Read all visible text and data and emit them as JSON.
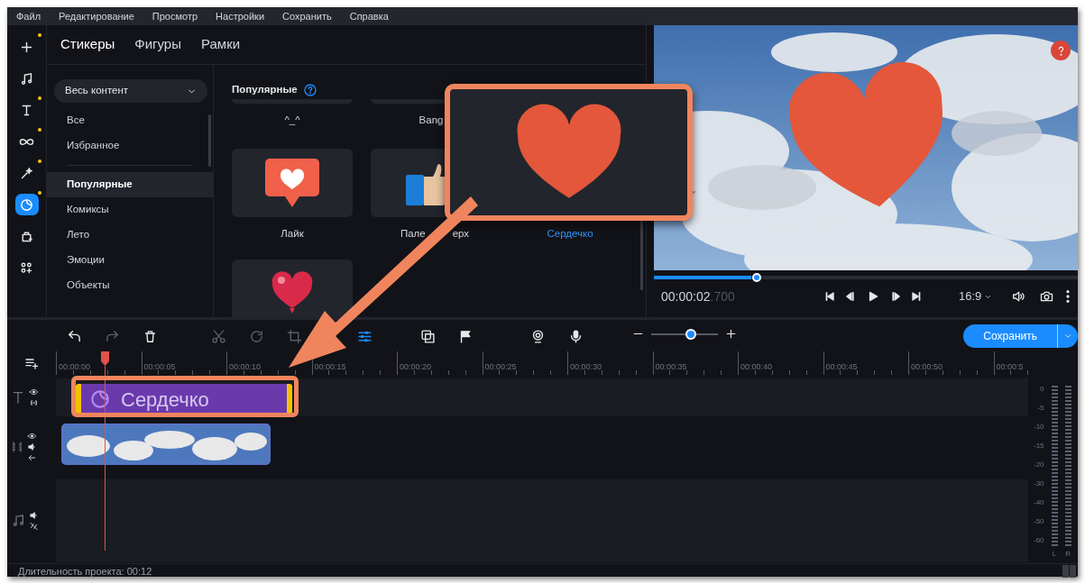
{
  "menu": [
    "Файл",
    "Редактирование",
    "Просмотр",
    "Настройки",
    "Сохранить",
    "Справка"
  ],
  "tool_rail": [
    {
      "kind": "add",
      "selected": false,
      "badge": true
    },
    {
      "kind": "music",
      "selected": false,
      "badge": false
    },
    {
      "kind": "text",
      "selected": false,
      "badge": true
    },
    {
      "kind": "transition",
      "selected": false,
      "badge": true
    },
    {
      "kind": "magic",
      "selected": false,
      "badge": true
    },
    {
      "kind": "sticker",
      "selected": true,
      "badge": true
    },
    {
      "kind": "clip",
      "selected": false,
      "badge": false
    },
    {
      "kind": "more",
      "selected": false,
      "badge": false
    }
  ],
  "tabs": [
    {
      "label": "Стикеры",
      "selected": true
    },
    {
      "label": "Фигуры",
      "selected": false
    },
    {
      "label": "Рамки",
      "selected": false
    }
  ],
  "categories": {
    "dropdown": "Весь контент",
    "filters": [
      {
        "label": "Все",
        "selected": false
      },
      {
        "label": "Избранное",
        "selected": false
      }
    ],
    "items": [
      {
        "label": "Популярные",
        "selected": true
      },
      {
        "label": "Комиксы",
        "selected": false
      },
      {
        "label": "Лето",
        "selected": false
      },
      {
        "label": "Эмоции",
        "selected": false
      },
      {
        "label": "Объекты",
        "selected": false
      }
    ]
  },
  "gallery": {
    "title": "Популярные",
    "partial_row": [
      "^_^",
      "Bang"
    ],
    "stickers": [
      {
        "kind": "like",
        "label": "Лайк",
        "selected": false
      },
      {
        "kind": "thumb",
        "label_parts": [
          "Пале",
          "ерх"
        ],
        "selected": false
      },
      {
        "kind": "heart",
        "label": "Сердечко",
        "selected": true
      },
      {
        "kind": "balloon"
      }
    ]
  },
  "preview": {
    "progress": {
      "level": 0.23
    },
    "time": "00:00:02",
    "time_fraction": ".700",
    "aspect": "16:9"
  },
  "timeline": {
    "tools": [
      [
        {
          "kind": "undo",
          "disabled": false,
          "active": false
        },
        {
          "kind": "redo",
          "disabled": true,
          "active": false
        },
        {
          "kind": "delete",
          "disabled": false,
          "active": false
        }
      ],
      [
        {
          "kind": "cut",
          "disabled": true,
          "active": false
        },
        {
          "kind": "rotate",
          "disabled": true,
          "active": false
        },
        {
          "kind": "crop",
          "disabled": true,
          "active": false
        },
        {
          "kind": "adjust",
          "disabled": false,
          "active": true
        }
      ],
      [
        {
          "kind": "overlay",
          "disabled": false,
          "active": false
        },
        {
          "kind": "flag",
          "disabled": false,
          "active": false
        }
      ],
      [
        {
          "kind": "webcam",
          "disabled": false,
          "active": false
        },
        {
          "kind": "mic",
          "disabled": false,
          "active": false
        }
      ]
    ],
    "zoom": {
      "level": 0.6
    },
    "save_button": "Сохранить",
    "ruler": [
      "00:00:00",
      "00:00:05",
      "00:00:10",
      "00:00:15",
      "00:00:20",
      "00:00:25",
      "00:00:30",
      "00:00:35",
      "00:00:40",
      "00:00:45",
      "00:00:50",
      "00:00:5"
    ],
    "tracks": [
      {
        "kind": "text",
        "clip": {
          "kind": "sticker",
          "label": "Сердечко"
        }
      },
      {
        "kind": "video",
        "clip": {
          "kind": "video"
        }
      },
      {
        "kind": "audio"
      }
    ],
    "meter": {
      "scale": [
        "0",
        "-5",
        "-10",
        "-15",
        "-20",
        "-30",
        "-40",
        "-50",
        "-60"
      ],
      "channels": [
        "L",
        "R"
      ]
    },
    "status": "Длительность проекта: 00:12"
  }
}
